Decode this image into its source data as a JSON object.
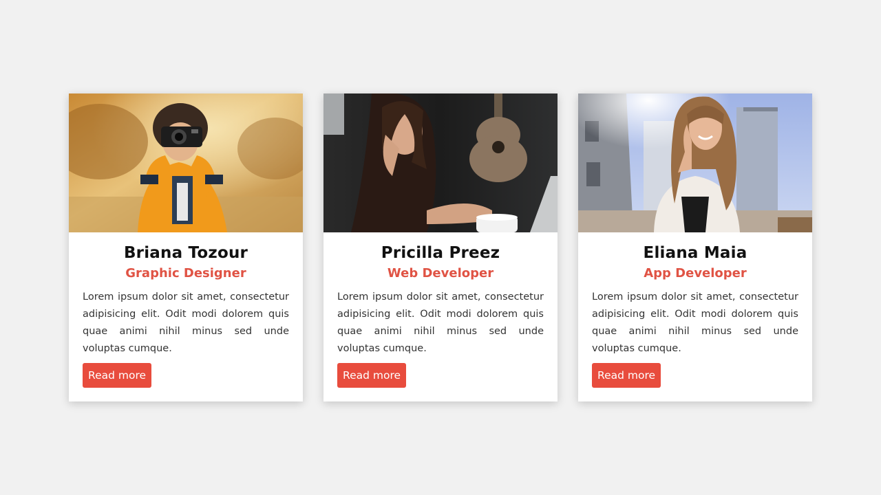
{
  "colors": {
    "page_background": "#f1f1f1",
    "card_background": "#ffffff",
    "accent": "#e84c3d",
    "role_text": "#e05344"
  },
  "cards": [
    {
      "name": "Briana Tozour",
      "role": "Graphic Designer",
      "description": "Lorem ipsum dolor sit amet, consectetur adipisicing elit. Odit modi dolorem quis quae animi nihil minus sed unde voluptas cumque.",
      "button_label": "Read more",
      "photo_subject": "person-with-camera"
    },
    {
      "name": "Pricilla Preez",
      "role": "Web Developer",
      "description": "Lorem ipsum dolor sit amet, consectetur adipisicing elit. Odit modi dolorem quis quae animi nihil minus sed unde voluptas cumque.",
      "button_label": "Read more",
      "photo_subject": "woman-at-laptop"
    },
    {
      "name": "Eliana Maia",
      "role": "App Developer",
      "description": "Lorem ipsum dolor sit amet, consectetur adipisicing elit. Odit modi dolorem quis quae animi nihil minus sed unde voluptas cumque.",
      "button_label": "Read more",
      "photo_subject": "woman-on-phone"
    }
  ]
}
